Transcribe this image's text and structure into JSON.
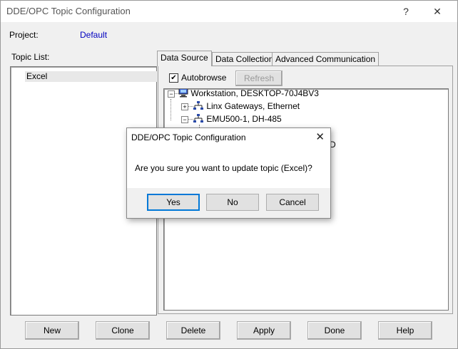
{
  "window": {
    "title": "DDE/OPC Topic Configuration",
    "help_label": "?",
    "close_label": "✕"
  },
  "project": {
    "label": "Project:",
    "value": "Default"
  },
  "topic_list": {
    "label": "Topic List:",
    "items": [
      "Excel"
    ]
  },
  "tabs": [
    {
      "label": "Data Source",
      "active": true
    },
    {
      "label": "Data Collection",
      "active": false
    },
    {
      "label": "Advanced Communication",
      "active": false
    }
  ],
  "data_source": {
    "autobrowse_label": "Autobrowse",
    "autobrowse_checked": true,
    "refresh_label": "Refresh",
    "tree": [
      {
        "label": "Workstation, DESKTOP-70J4BV3",
        "icon": "computer-icon",
        "expander": "−"
      },
      {
        "label": "Linx Gateways, Ethernet",
        "icon": "network-icon",
        "expander": "+"
      },
      {
        "label": "EMU500-1, DH-485",
        "icon": "network-icon",
        "expander": "−"
      }
    ],
    "partial_text": "D"
  },
  "buttons": {
    "new": "New",
    "clone": "Clone",
    "delete": "Delete",
    "apply": "Apply",
    "done": "Done",
    "help": "Help"
  },
  "dialog": {
    "title": "DDE/OPC Topic Configuration",
    "close_label": "✕",
    "message": "Are you sure you want to update topic (Excel)?",
    "yes": "Yes",
    "no": "No",
    "cancel": "Cancel"
  }
}
